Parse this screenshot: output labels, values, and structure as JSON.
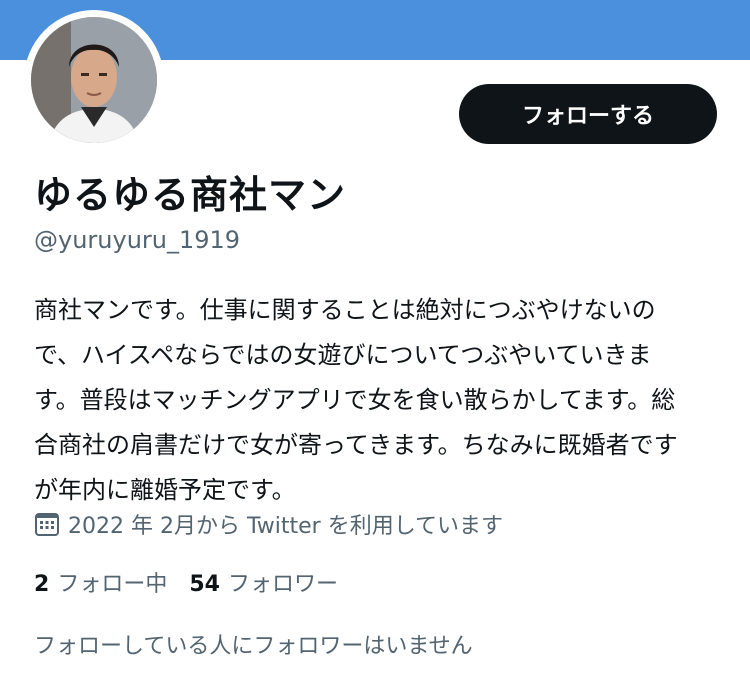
{
  "profile": {
    "display_name": "ゆるゆる商社マン",
    "handle": "@yuruyuru_1919",
    "bio": "商社マンです。仕事に関することは絶対につぶやけないので、ハイスペならではの女遊びについてつぶやいていきます。普段はマッチングアプリで女を食い散らかしてます。総合商社の肩書だけで女が寄ってきます。ちなみに既婚者ですが年内に離婚予定です。",
    "joined": "2022 年 2月から Twitter を利用しています",
    "follow_button_label": "フォローする",
    "avatar_icon": "profile-photo",
    "calendar_icon": "calendar-icon"
  },
  "stats": {
    "following_count": "2",
    "following_label": "フォロー中",
    "followers_count": "54",
    "followers_label": "フォロワー"
  },
  "mutuals_text": "フォローしている人にフォロワーはいません",
  "colors": {
    "banner": "#4a90dc",
    "button_bg": "#0f1419",
    "secondary_text": "#536471"
  }
}
